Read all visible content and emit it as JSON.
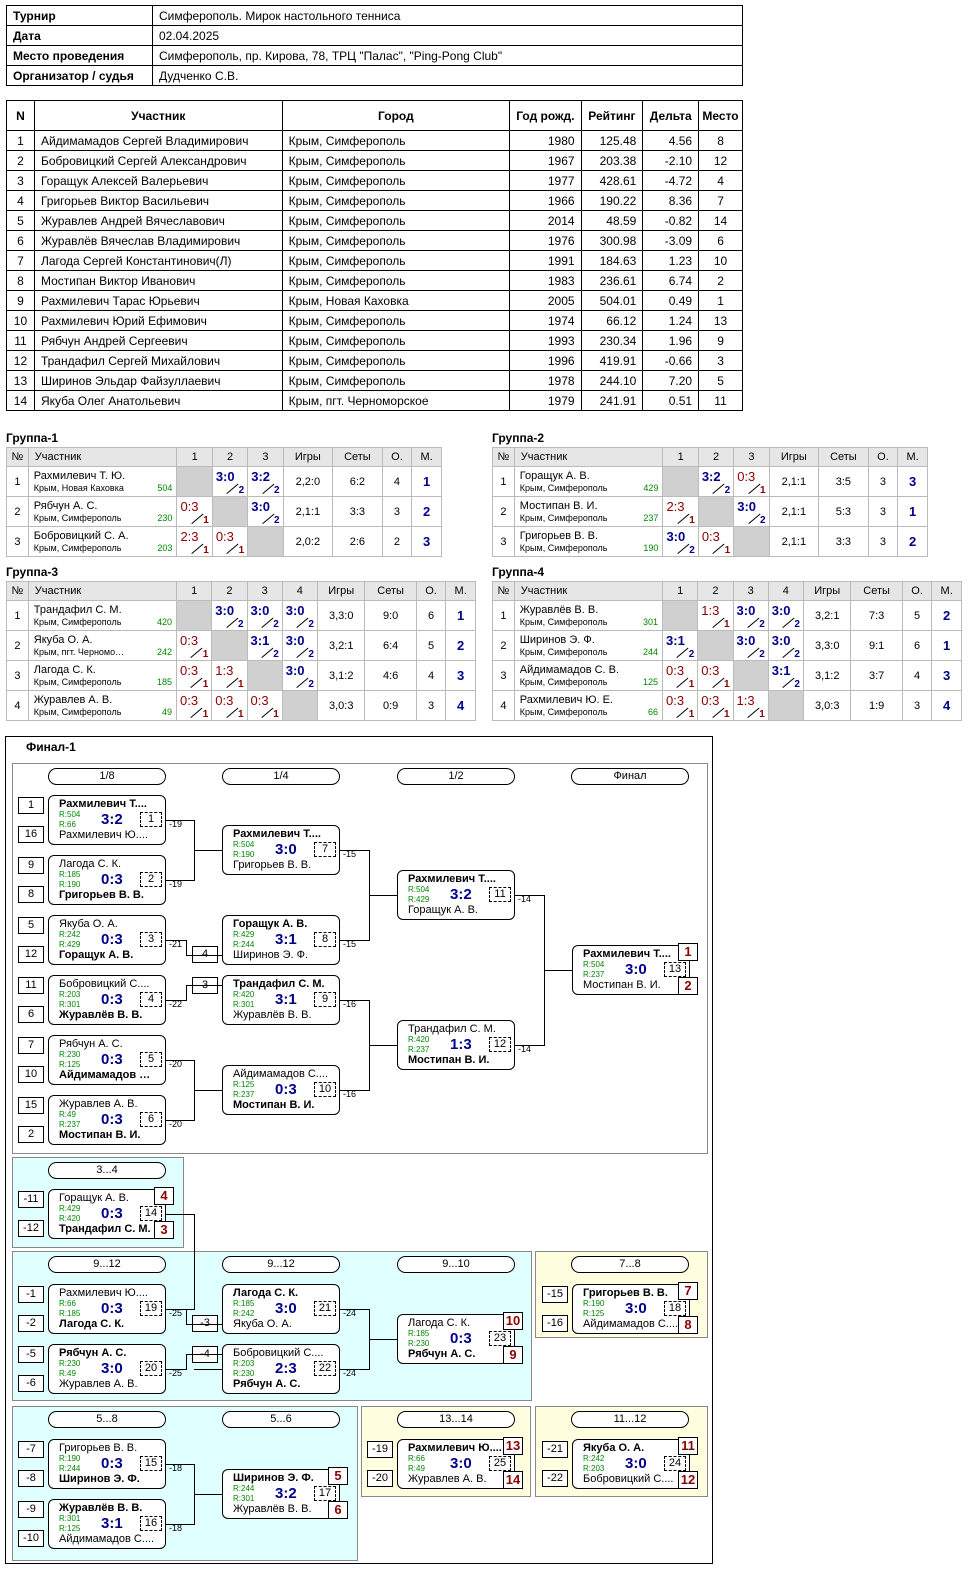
{
  "info": [
    {
      "k": "Турнир",
      "v": "Симферополь. Мирок настольного тенниса"
    },
    {
      "k": "Дата",
      "v": "02.04.2025"
    },
    {
      "k": "Место проведения",
      "v": "Симферополь, пр. Кирова, 78, ТРЦ \"Палас\", \"Ping-Pong Club\""
    },
    {
      "k": "Организатор / судья",
      "v": "Дудченко С.В."
    }
  ],
  "participants_head": [
    "N",
    "Участник",
    "Город",
    "Год рожд.",
    "Рейтинг",
    "Дельта",
    "Место"
  ],
  "participants": [
    [
      "1",
      "Айдимамадов Сергей Владимирович",
      "Крым, Симферополь",
      "1980",
      "125.48",
      "4.56",
      "8"
    ],
    [
      "2",
      "Бобровицкий Сергей Александрович",
      "Крым, Симферополь",
      "1967",
      "203.38",
      "-2.10",
      "12"
    ],
    [
      "3",
      "Горащук Алексей Валерьевич",
      "Крым, Симферополь",
      "1977",
      "428.61",
      "-4.72",
      "4"
    ],
    [
      "4",
      "Григорьев Виктор Васильевич",
      "Крым, Симферополь",
      "1966",
      "190.22",
      "8.36",
      "7"
    ],
    [
      "5",
      "Журавлев Андрей Вячеславович",
      "Крым, Симферополь",
      "2014",
      "48.59",
      "-0.82",
      "14"
    ],
    [
      "6",
      "Журавлёв Вячеслав Владимирович",
      "Крым, Симферополь",
      "1976",
      "300.98",
      "-3.09",
      "6"
    ],
    [
      "7",
      "Лагода Сергей Константинович(Л)",
      "Крым, Симферополь",
      "1991",
      "184.63",
      "1.23",
      "10"
    ],
    [
      "8",
      "Мостипан Виктор Иванович",
      "Крым, Симферополь",
      "1983",
      "236.61",
      "6.74",
      "2"
    ],
    [
      "9",
      "Рахмилевич Тарас Юрьевич",
      "Крым, Новая Каховка",
      "2005",
      "504.01",
      "0.49",
      "1"
    ],
    [
      "10",
      "Рахмилевич Юрий Ефимович",
      "Крым, Симферополь",
      "1974",
      "66.12",
      "1.24",
      "13"
    ],
    [
      "11",
      "Рябчун Андрей Сергеевич",
      "Крым, Симферополь",
      "1993",
      "230.34",
      "1.96",
      "9"
    ],
    [
      "12",
      "Трандафил Сергей Михайлович",
      "Крым, Симферополь",
      "1996",
      "419.91",
      "-0.66",
      "3"
    ],
    [
      "13",
      "Ширинов Эльдар Файзуллаевич",
      "Крым, Симферополь",
      "1978",
      "244.10",
      "7.20",
      "5"
    ],
    [
      "14",
      "Якуба Олег Анатольевич",
      "Крым, пгт. Черноморское",
      "1979",
      "241.91",
      "0.51",
      "11"
    ]
  ],
  "group_head": {
    "n": "№",
    "p": "Участник",
    "games": "Игры",
    "sets": "Сеты",
    "o": "О.",
    "m": "М."
  },
  "groups": [
    {
      "title": "Группа-1",
      "rows": [
        {
          "n": "1",
          "name": "Рахмилевич Т. Ю.",
          "city": "Крым, Новая Каховка",
          "r": "504",
          "cells": [
            null,
            [
              "3:0",
              "2",
              "w"
            ],
            [
              "3:2",
              "2",
              "w"
            ]
          ],
          "games": "2,2:0",
          "sets": "6:2",
          "o": "4",
          "m": "1"
        },
        {
          "n": "2",
          "name": "Рябчун А. С.",
          "city": "Крым, Симферополь",
          "r": "230",
          "cells": [
            [
              "0:3",
              "1",
              "l"
            ],
            null,
            [
              "3:0",
              "2",
              "w"
            ]
          ],
          "games": "2,1:1",
          "sets": "3:3",
          "o": "3",
          "m": "2"
        },
        {
          "n": "3",
          "name": "Бобровицкий С. А.",
          "city": "Крым, Симферополь",
          "r": "203",
          "cells": [
            [
              "2:3",
              "1",
              "l"
            ],
            [
              "0:3",
              "1",
              "l"
            ],
            null
          ],
          "games": "2,0:2",
          "sets": "2:6",
          "o": "2",
          "m": "3"
        }
      ]
    },
    {
      "title": "Группа-2",
      "rows": [
        {
          "n": "1",
          "name": "Горащук А. В.",
          "city": "Крым, Симферополь",
          "r": "429",
          "cells": [
            null,
            [
              "3:2",
              "2",
              "w"
            ],
            [
              "0:3",
              "1",
              "l"
            ]
          ],
          "games": "2,1:1",
          "sets": "3:5",
          "o": "3",
          "m": "3"
        },
        {
          "n": "2",
          "name": "Мостипан В. И.",
          "city": "Крым, Симферополь",
          "r": "237",
          "cells": [
            [
              "2:3",
              "1",
              "l"
            ],
            null,
            [
              "3:0",
              "2",
              "w"
            ]
          ],
          "games": "2,1:1",
          "sets": "5:3",
          "o": "3",
          "m": "1"
        },
        {
          "n": "3",
          "name": "Григорьев В. В.",
          "city": "Крым, Симферополь",
          "r": "190",
          "cells": [
            [
              "3:0",
              "2",
              "w"
            ],
            [
              "0:3",
              "1",
              "l"
            ],
            null
          ],
          "games": "2,1:1",
          "sets": "3:3",
          "o": "3",
          "m": "2"
        }
      ]
    },
    {
      "title": "Группа-3",
      "rows": [
        {
          "n": "1",
          "name": "Трандафил С. М.",
          "city": "Крым, Симферополь",
          "r": "420",
          "cells": [
            null,
            [
              "3:0",
              "2",
              "w"
            ],
            [
              "3:0",
              "2",
              "w"
            ],
            [
              "3:0",
              "2",
              "w"
            ]
          ],
          "games": "3,3:0",
          "sets": "9:0",
          "o": "6",
          "m": "1"
        },
        {
          "n": "2",
          "name": "Якуба О. А.",
          "city": "Крым, пгт. Черномо…",
          "r": "242",
          "cells": [
            [
              "0:3",
              "1",
              "l"
            ],
            null,
            [
              "3:1",
              "2",
              "w"
            ],
            [
              "3:0",
              "2",
              "w"
            ]
          ],
          "games": "3,2:1",
          "sets": "6:4",
          "o": "5",
          "m": "2"
        },
        {
          "n": "3",
          "name": "Лагода С. К.",
          "city": "Крым, Симферополь",
          "r": "185",
          "cells": [
            [
              "0:3",
              "1",
              "l"
            ],
            [
              "1:3",
              "1",
              "l"
            ],
            null,
            [
              "3:0",
              "2",
              "w"
            ]
          ],
          "games": "3,1:2",
          "sets": "4:6",
          "o": "4",
          "m": "3"
        },
        {
          "n": "4",
          "name": "Журавлев А. В.",
          "city": "Крым, Симферополь",
          "r": "49",
          "cells": [
            [
              "0:3",
              "1",
              "l"
            ],
            [
              "0:3",
              "1",
              "l"
            ],
            [
              "0:3",
              "1",
              "l"
            ],
            null
          ],
          "games": "3,0:3",
          "sets": "0:9",
          "o": "3",
          "m": "4"
        }
      ]
    },
    {
      "title": "Группа-4",
      "rows": [
        {
          "n": "1",
          "name": "Журавлёв В. В.",
          "city": "Крым, Симферополь",
          "r": "301",
          "cells": [
            null,
            [
              "1:3",
              "1",
              "l"
            ],
            [
              "3:0",
              "2",
              "w"
            ],
            [
              "3:0",
              "2",
              "w"
            ]
          ],
          "games": "3,2:1",
          "sets": "7:3",
          "o": "5",
          "m": "2"
        },
        {
          "n": "2",
          "name": "Ширинов Э. Ф.",
          "city": "Крым, Симферополь",
          "r": "244",
          "cells": [
            [
              "3:1",
              "2",
              "w"
            ],
            null,
            [
              "3:0",
              "2",
              "w"
            ],
            [
              "3:0",
              "2",
              "w"
            ]
          ],
          "games": "3,3:0",
          "sets": "9:1",
          "o": "6",
          "m": "1"
        },
        {
          "n": "3",
          "name": "Айдимамадов С. В.",
          "city": "Крым, Симферополь",
          "r": "125",
          "cells": [
            [
              "0:3",
              "1",
              "l"
            ],
            [
              "0:3",
              "1",
              "l"
            ],
            null,
            [
              "3:1",
              "2",
              "w"
            ]
          ],
          "games": "3,1:2",
          "sets": "3:7",
          "o": "4",
          "m": "3"
        },
        {
          "n": "4",
          "name": "Рахмилевич Ю. Е.",
          "city": "Крым, Симферополь",
          "r": "66",
          "cells": [
            [
              "0:3",
              "1",
              "l"
            ],
            [
              "0:3",
              "1",
              "l"
            ],
            [
              "1:3",
              "1",
              "l"
            ],
            null
          ],
          "games": "3,0:3",
          "sets": "1:9",
          "o": "3",
          "m": "4"
        }
      ]
    }
  ],
  "final": {
    "title": "Финал-1",
    "rounds": [
      "1/8",
      "1/4",
      "1/2",
      "Финал",
      "3...4",
      "9...12",
      "9...12",
      "9...10",
      "7...8",
      "5...8",
      "5...6",
      "13...14",
      "11...12"
    ],
    "matches": [
      {
        "a": "Рахмилевич Т....",
        "ra": "R:504",
        "b": "Рахмилевич Ю....",
        "rb": "R:66",
        "s": "3:2",
        "n": "1",
        "w": "a",
        "sa": "1",
        "sb": "16",
        "lk": "-19"
      },
      {
        "a": "Лагода С. К.",
        "ra": "R:185",
        "b": "Григорьев В. В.",
        "rb": "R:190",
        "s": "0:3",
        "n": "2",
        "w": "b",
        "sa": "9",
        "sb": "8",
        "lk": "-19"
      },
      {
        "a": "Якуба О. А.",
        "ra": "R:242",
        "b": "Горащук А. В.",
        "rb": "R:429",
        "s": "0:3",
        "n": "3",
        "w": "b",
        "sa": "5",
        "sb": "12",
        "lk": "-21"
      },
      {
        "a": "Бобровицкий С....",
        "ra": "R:203",
        "b": "Журавлёв В. В.",
        "rb": "R:301",
        "s": "0:3",
        "n": "4",
        "w": "b",
        "sa": "11",
        "sb": "6",
        "lk": "-22"
      },
      {
        "a": "Рябчун А. С.",
        "ra": "R:230",
        "b": "Айдимамадов С....",
        "rb": "R:125",
        "s": "0:3",
        "n": "5",
        "w": "b",
        "sa": "7",
        "sb": "10",
        "lk": "-20"
      },
      {
        "a": "Журавлев А. В.",
        "ra": "R:49",
        "b": "Мостипан В. И.",
        "rb": "R:237",
        "s": "0:3",
        "n": "6",
        "w": "b",
        "sa": "15",
        "sb": "2",
        "lk": "-20"
      },
      {
        "a": "Рахмилевич Т....",
        "ra": "R:504",
        "b": "Григорьев В. В.",
        "rb": "R:190",
        "s": "3:0",
        "n": "7",
        "w": "a",
        "lk": "-15"
      },
      {
        "a": "Горащук А. В.",
        "ra": "R:429",
        "b": "Ширинов Э. Ф.",
        "rb": "R:244",
        "s": "3:1",
        "n": "8",
        "w": "a",
        "sb": "4",
        "lk": "-15"
      },
      {
        "a": "Трандафил С. М.",
        "ra": "R:420",
        "b": "Журавлёв В. В.",
        "rb": "R:301",
        "s": "3:1",
        "n": "9",
        "w": "a",
        "sa": "3",
        "lk": "-16"
      },
      {
        "a": "Айдимамадов С....",
        "ra": "R:125",
        "b": "Мостипан В. И.",
        "rb": "R:237",
        "s": "0:3",
        "n": "10",
        "w": "b",
        "lk": "-16"
      },
      {
        "a": "Рахмилевич Т....",
        "ra": "R:504",
        "b": "Горащук А. В.",
        "rb": "R:429",
        "s": "3:2",
        "n": "11",
        "w": "a",
        "lk": "-14"
      },
      {
        "a": "Трандафил С. М.",
        "ra": "R:420",
        "b": "Мостипан В. И.",
        "rb": "R:237",
        "s": "1:3",
        "n": "12",
        "w": "b",
        "lk": "-14"
      },
      {
        "a": "Рахмилевич Т....",
        "ra": "R:504",
        "b": "Мостипан В. И.",
        "rb": "R:237",
        "s": "3:0",
        "n": "13",
        "w": "a",
        "pa": "1",
        "pb": "2"
      },
      {
        "a": "Горащук А. В.",
        "ra": "R:429",
        "b": "Трандафил С. М.",
        "rb": "R:420",
        "s": "0:3",
        "n": "14",
        "w": "b",
        "sa": "-11",
        "sb": "-12",
        "pa": "4",
        "pb": "3"
      },
      {
        "a": "Рахмилевич Ю....",
        "ra": "R:66",
        "b": "Лагода С. К.",
        "rb": "R:185",
        "s": "0:3",
        "n": "19",
        "w": "b",
        "sa": "-1",
        "sb": "-2",
        "lk": "-25"
      },
      {
        "a": "Рябчун А. С.",
        "ra": "R:230",
        "b": "Журавлев А. В.",
        "rb": "R:49",
        "s": "3:0",
        "n": "20",
        "w": "a",
        "sa": "-5",
        "sb": "-6",
        "lk": "-25"
      },
      {
        "a": "Лагода С. К.",
        "ra": "R:185",
        "b": "Якуба О. А.",
        "rb": "R:242",
        "s": "3:0",
        "n": "21",
        "w": "a",
        "sb": "-3",
        "lk": "-24"
      },
      {
        "a": "Бобровицкий С....",
        "ra": "R:203",
        "b": "Рябчун А. С.",
        "rb": "R:230",
        "s": "2:3",
        "n": "22",
        "w": "b",
        "sa": "-4",
        "lk": "-24"
      },
      {
        "a": "Лагода С. К.",
        "ra": "R:185",
        "b": "Рябчун А. С.",
        "rb": "R:230",
        "s": "0:3",
        "n": "23",
        "w": "b",
        "pa": "10",
        "pb": "9"
      },
      {
        "a": "Григорьев В. В.",
        "ra": "R:190",
        "b": "Айдимамадов С....",
        "rb": "R:125",
        "s": "3:0",
        "n": "18",
        "w": "a",
        "sa": "-15",
        "sb": "-16",
        "pa": "7",
        "pb": "8"
      },
      {
        "a": "Григорьев В. В.",
        "ra": "R:190",
        "b": "Ширинов Э. Ф.",
        "rb": "R:244",
        "s": "0:3",
        "n": "15",
        "w": "b",
        "sa": "-7",
        "sb": "-8",
        "lk": "-18"
      },
      {
        "a": "Журавлёв В. В.",
        "ra": "R:301",
        "b": "Айдимамадов С....",
        "rb": "R:125",
        "s": "3:1",
        "n": "16",
        "w": "a",
        "sa": "-9",
        "sb": "-10",
        "lk": "-18"
      },
      {
        "a": "Ширинов Э. Ф.",
        "ra": "R:244",
        "b": "Журавлёв В. В.",
        "rb": "R:301",
        "s": "3:2",
        "n": "17",
        "w": "a",
        "pa": "5",
        "pb": "6"
      },
      {
        "a": "Рахмилевич Ю....",
        "ra": "R:66",
        "b": "Журавлев А. В.",
        "rb": "R:49",
        "s": "3:0",
        "n": "25",
        "w": "a",
        "sa": "-19",
        "sb": "-20",
        "pa": "13",
        "pb": "14"
      },
      {
        "a": "Якуба О. А.",
        "ra": "R:242",
        "b": "Бобровицкий С....",
        "rb": "R:203",
        "s": "3:0",
        "n": "24",
        "w": "a",
        "sa": "-21",
        "sb": "-22",
        "pa": "11",
        "pb": "12"
      }
    ]
  },
  "colors": {
    "win": "#00008b",
    "lose": "#8b0000",
    "rating": "#008000",
    "panel_cyan": "#e0ffff",
    "panel_yellow": "#ffffe0",
    "panel_gray": "#f0f0f0"
  }
}
